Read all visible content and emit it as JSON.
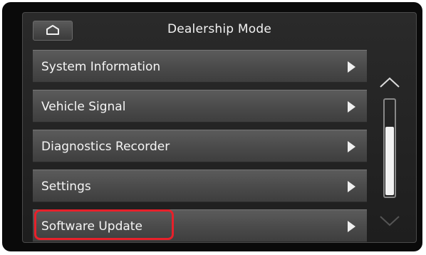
{
  "header": {
    "title": "Dealership Mode",
    "home_icon": "home-icon"
  },
  "menu": {
    "items": [
      {
        "label": "System Information",
        "icon": "chevron-right-icon"
      },
      {
        "label": "Vehicle Signal",
        "icon": "chevron-right-icon"
      },
      {
        "label": "Diagnostics Recorder",
        "icon": "chevron-right-icon"
      },
      {
        "label": "Settings",
        "icon": "chevron-right-icon"
      },
      {
        "label": "Software Update",
        "icon": "chevron-right-icon"
      }
    ],
    "highlighted_item": "Software Update"
  },
  "scrollbar": {
    "up_icon": "chevron-up-icon",
    "down_icon": "chevron-down-icon",
    "position_fraction": 1.0
  },
  "colors": {
    "highlight": "#e8202a",
    "background": "#0a0a0a",
    "item": "#4a4a4a",
    "text": "#f5f5f5"
  }
}
